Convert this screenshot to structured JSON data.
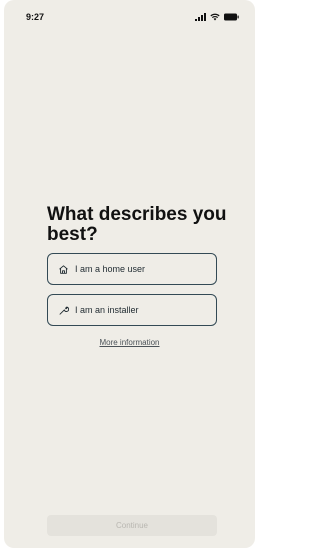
{
  "status_bar": {
    "time": "9:27",
    "icons": [
      "signal-icon",
      "wifi-icon",
      "battery-icon"
    ]
  },
  "main": {
    "title": "What describes you best?",
    "options": [
      {
        "label": "I am a home user",
        "icon": "home-icon"
      },
      {
        "label": "I am an installer",
        "icon": "wrench-icon"
      }
    ],
    "more_info_link": "More information",
    "continue_button": "Continue"
  },
  "colors": {
    "background": "#efede7",
    "option_border": "#334a55",
    "button_disabled_bg": "#e4e2dc",
    "button_disabled_text": "#b9b7b1"
  }
}
